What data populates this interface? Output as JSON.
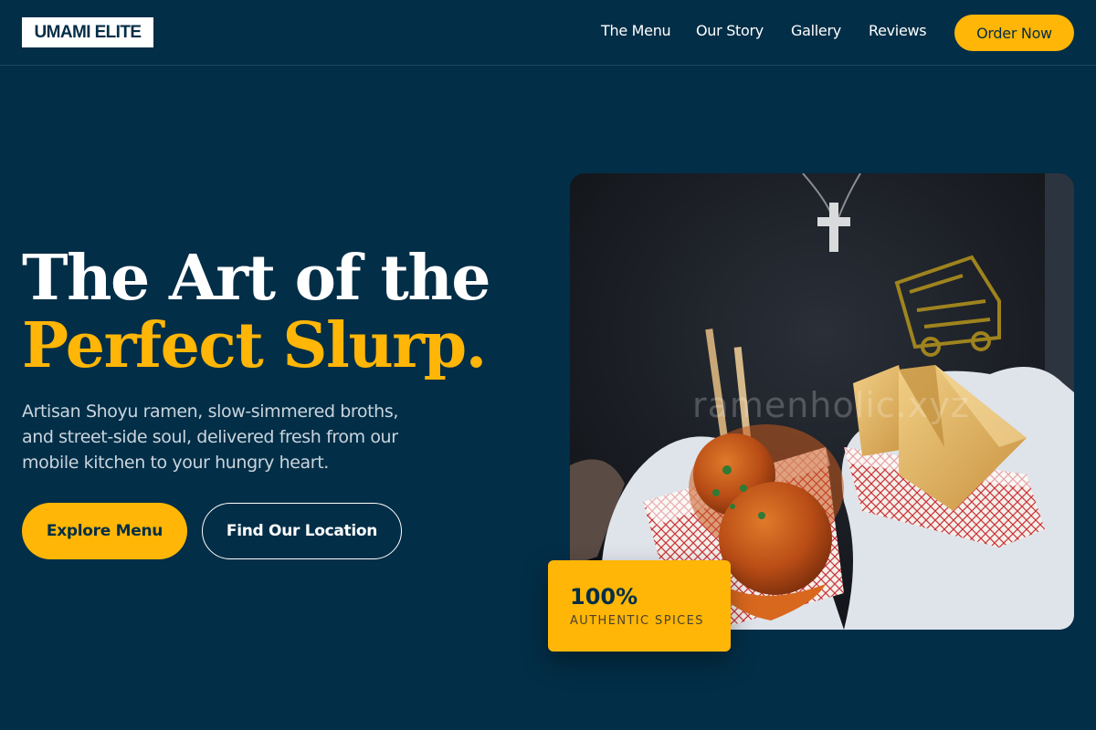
{
  "brand": {
    "logo_text": "UMAMI ELITE"
  },
  "nav": {
    "links": [
      "The Menu",
      "Our Story",
      "Gallery",
      "Reviews"
    ],
    "cta_label": "Order Now"
  },
  "hero": {
    "title_line1": "The Art of the",
    "title_line2": "Perfect Slurp.",
    "subtitle": "Artisan Shoyu ramen, slow-simmered broths, and street-side soul, delivered fresh from our mobile kitchen to your hungry heart.",
    "primary_button": "Explore Menu",
    "secondary_button": "Find Our Location"
  },
  "photo": {
    "watermark": "ramenholic.xyz"
  },
  "badge": {
    "value": "100%",
    "label": "AUTHENTIC SPICES"
  },
  "colors": {
    "background": "#032e47",
    "accent": "#ffb606",
    "white": "#ffffff",
    "subtitle_text": "#c9d5de"
  }
}
